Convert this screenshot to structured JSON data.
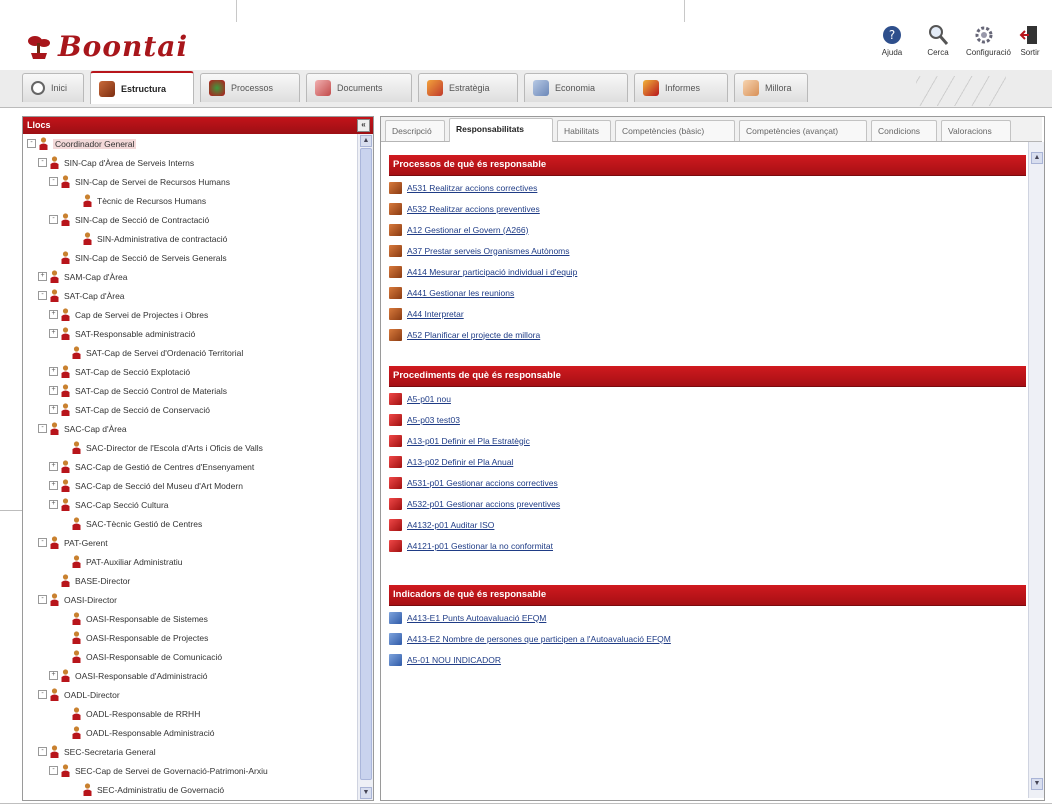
{
  "app": {
    "logo_text": "Boontai",
    "brand_color": "#b8151b"
  },
  "toolbar": [
    {
      "label": "Ajuda",
      "icon": "help-icon"
    },
    {
      "label": "Cerca",
      "icon": "search-icon"
    },
    {
      "label": "Configuració",
      "icon": "gear-icon"
    },
    {
      "label": "Sortir",
      "icon": "exit-door-icon"
    }
  ],
  "main_tabs": [
    {
      "label": "Inici",
      "icon": "home-icon",
      "active": false
    },
    {
      "label": "Estructura",
      "icon": "structure-icon",
      "active": true
    },
    {
      "label": "Processos",
      "icon": "processes-icon",
      "active": false
    },
    {
      "label": "Documents",
      "icon": "documents-icon",
      "active": false
    },
    {
      "label": "Estratègia",
      "icon": "strategy-icon",
      "active": false
    },
    {
      "label": "Economia",
      "icon": "economy-icon",
      "active": false
    },
    {
      "label": "Informes",
      "icon": "reports-icon",
      "active": false
    },
    {
      "label": "Millora",
      "icon": "improvement-icon",
      "active": false
    }
  ],
  "tree_panel": {
    "title": "Llocs",
    "items": [
      {
        "label": "Coordinador General",
        "expander": "-",
        "selected": true
      },
      {
        "label": "SIN-Cap d'Àrea de Serveis Interns",
        "expander": "-"
      },
      {
        "label": "SIN-Cap de Servei de Recursos Humans",
        "expander": "-"
      },
      {
        "label": "Tècnic de Recursos Humans",
        "expander": ""
      },
      {
        "label": "SIN-Cap de Secció de Contractació",
        "expander": "-"
      },
      {
        "label": "SIN-Administrativa de contractació",
        "expander": ""
      },
      {
        "label": "SIN-Cap de Secció de Serveis Generals",
        "expander": ""
      },
      {
        "label": "SAM-Cap d'Àrea",
        "expander": "+"
      },
      {
        "label": "SAT-Cap d'Àrea",
        "expander": "-"
      },
      {
        "label": "Cap de Servei de Projectes i Obres",
        "expander": "+"
      },
      {
        "label": "SAT-Responsable administració",
        "expander": "+"
      },
      {
        "label": "SAT-Cap de Servei d'Ordenació Territorial",
        "expander": ""
      },
      {
        "label": "SAT-Cap de Secció Explotació",
        "expander": "+"
      },
      {
        "label": "SAT-Cap de Secció Control de Materials",
        "expander": "+"
      },
      {
        "label": "SAT-Cap de Secció de Conservació",
        "expander": "+"
      },
      {
        "label": "SAC-Cap d'Àrea",
        "expander": "-"
      },
      {
        "label": "SAC-Director de l'Escola d'Arts i Oficis de Valls",
        "expander": ""
      },
      {
        "label": "SAC-Cap de Gestió de Centres d'Ensenyament",
        "expander": "+"
      },
      {
        "label": "SAC-Cap de Secció del Museu d'Art Modern",
        "expander": "+"
      },
      {
        "label": "SAC-Cap Secció Cultura",
        "expander": "+"
      },
      {
        "label": "SAC-Tècnic Gestió de Centres",
        "expander": ""
      },
      {
        "label": "PAT-Gerent",
        "expander": "-"
      },
      {
        "label": "PAT-Auxiliar Administratiu",
        "expander": ""
      },
      {
        "label": "BASE-Director",
        "expander": ""
      },
      {
        "label": "OASI-Director",
        "expander": "-"
      },
      {
        "label": "OASI-Responsable de Sistemes",
        "expander": ""
      },
      {
        "label": "OASI-Responsable de Projectes",
        "expander": ""
      },
      {
        "label": "OASI-Responsable de Comunicació",
        "expander": ""
      },
      {
        "label": "OASI-Responsable d'Administració",
        "expander": "+"
      },
      {
        "label": "OADL-Director",
        "expander": "-"
      },
      {
        "label": "OADL-Responsable de RRHH",
        "expander": ""
      },
      {
        "label": "OADL-Responsable Administració",
        "expander": ""
      },
      {
        "label": "SEC-Secretaria General",
        "expander": "-"
      },
      {
        "label": "SEC-Cap de Servei de Governació-Patrimoni-Arxiu",
        "expander": "-"
      },
      {
        "label": "SEC-Administratiu de Governació",
        "expander": ""
      }
    ]
  },
  "sub_tabs": [
    {
      "label": "Descripció",
      "active": false
    },
    {
      "label": "Responsabilitats",
      "active": true
    },
    {
      "label": "Habilitats",
      "active": false
    },
    {
      "label": "Competències (bàsic)",
      "active": false
    },
    {
      "label": "Competències (avançat)",
      "active": false
    },
    {
      "label": "Condicions",
      "active": false
    },
    {
      "label": "Valoracions",
      "active": false
    }
  ],
  "sections": [
    {
      "title": "Processos de què és responsable",
      "icon": "process-icon",
      "items": [
        "A531 Realitzar accions correctives",
        "A532 Realitzar accions preventives",
        "A12 Gestionar el Govern (A266)",
        "A37 Prestar serveis Organismes Autònoms",
        "A414 Mesurar participació individual i d'equip",
        "A441 Gestionar les reunions",
        "A44 Interpretar",
        "A52 Planificar el projecte de millora"
      ]
    },
    {
      "title": "Procediments de què és responsable",
      "icon": "procedure-icon",
      "items": [
        "A5-p01 nou",
        "A5-p03 test03",
        "A13-p01 Definir el Pla Estratègic",
        "A13-p02 Definir el Pla Anual",
        "A531-p01 Gestionar accions correctives",
        "A532-p01 Gestionar accions preventives",
        "A4132-p01 Auditar ISO",
        "A4121-p01 Gestionar la no conformitat"
      ]
    },
    {
      "title": "Indicadors de què és responsable",
      "icon": "indicator-icon",
      "items": [
        "A413-E1 Punts Autoavaluació EFQM",
        "A413-E2 Nombre de persones que participen a l'Autoavaluació EFQM",
        "A5-01 NOU INDICADOR"
      ]
    }
  ]
}
